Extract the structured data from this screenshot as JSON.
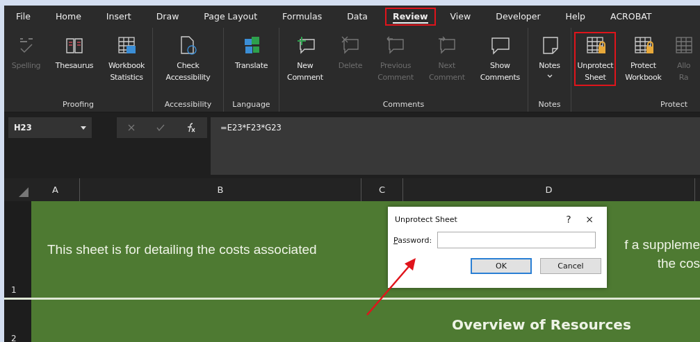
{
  "tabs": [
    {
      "label": "File",
      "selected": false,
      "highlighted": false
    },
    {
      "label": "Home",
      "selected": false,
      "highlighted": false
    },
    {
      "label": "Insert",
      "selected": false,
      "highlighted": false
    },
    {
      "label": "Draw",
      "selected": false,
      "highlighted": false
    },
    {
      "label": "Page Layout",
      "selected": false,
      "highlighted": false
    },
    {
      "label": "Formulas",
      "selected": false,
      "highlighted": false
    },
    {
      "label": "Data",
      "selected": false,
      "highlighted": false
    },
    {
      "label": "Review",
      "selected": true,
      "highlighted": true
    },
    {
      "label": "View",
      "selected": false,
      "highlighted": false
    },
    {
      "label": "Developer",
      "selected": false,
      "highlighted": false
    },
    {
      "label": "Help",
      "selected": false,
      "highlighted": false
    },
    {
      "label": "ACROBAT",
      "selected": false,
      "highlighted": false
    }
  ],
  "ribbon": {
    "groups": [
      {
        "label": "Proofing",
        "buttons": [
          {
            "label": "Spelling",
            "disabled": true,
            "highlighted": false
          },
          {
            "label": "Thesaurus",
            "disabled": false,
            "highlighted": false
          },
          {
            "label": "Workbook\nStatistics",
            "disabled": false,
            "highlighted": false
          }
        ]
      },
      {
        "label": "Accessibility",
        "buttons": [
          {
            "label": "Check\nAccessibility",
            "disabled": false,
            "highlighted": false
          }
        ]
      },
      {
        "label": "Language",
        "buttons": [
          {
            "label": "Translate",
            "disabled": false,
            "highlighted": false
          }
        ]
      },
      {
        "label": "Comments",
        "buttons": [
          {
            "label": "New\nComment",
            "disabled": false,
            "highlighted": false
          },
          {
            "label": "Delete",
            "disabled": true,
            "highlighted": false
          },
          {
            "label": "Previous\nComment",
            "disabled": true,
            "highlighted": false
          },
          {
            "label": "Next\nComment",
            "disabled": true,
            "highlighted": false
          },
          {
            "label": "Show\nComments",
            "disabled": false,
            "highlighted": false
          }
        ]
      },
      {
        "label": "Notes",
        "buttons": [
          {
            "label": "Notes",
            "disabled": false,
            "highlighted": false,
            "dropdown": true
          }
        ]
      },
      {
        "label": "Protect",
        "buttons": [
          {
            "label": "Unprotect\nSheet",
            "disabled": false,
            "highlighted": true
          },
          {
            "label": "Protect\nWorkbook",
            "disabled": false,
            "highlighted": false
          },
          {
            "label": "Allo\nRa",
            "disabled": true,
            "highlighted": false
          }
        ]
      }
    ]
  },
  "formula_bar": {
    "name_box": "H23",
    "formula": "=E23*F23*G23"
  },
  "columns": [
    "A",
    "B",
    "C",
    "D"
  ],
  "rows": [
    {
      "number": "1",
      "text_left": "This sheet is for detailing the costs associated",
      "text_right": [
        "f a suppleme",
        "the cos"
      ]
    },
    {
      "number": "2",
      "heading": "Overview of Resources"
    }
  ],
  "dialog": {
    "title": "Unprotect Sheet",
    "help": "?",
    "close": "×",
    "label": "Password:",
    "buttons": [
      {
        "label": "OK",
        "selected": true
      },
      {
        "label": "Cancel",
        "selected": false
      }
    ]
  }
}
